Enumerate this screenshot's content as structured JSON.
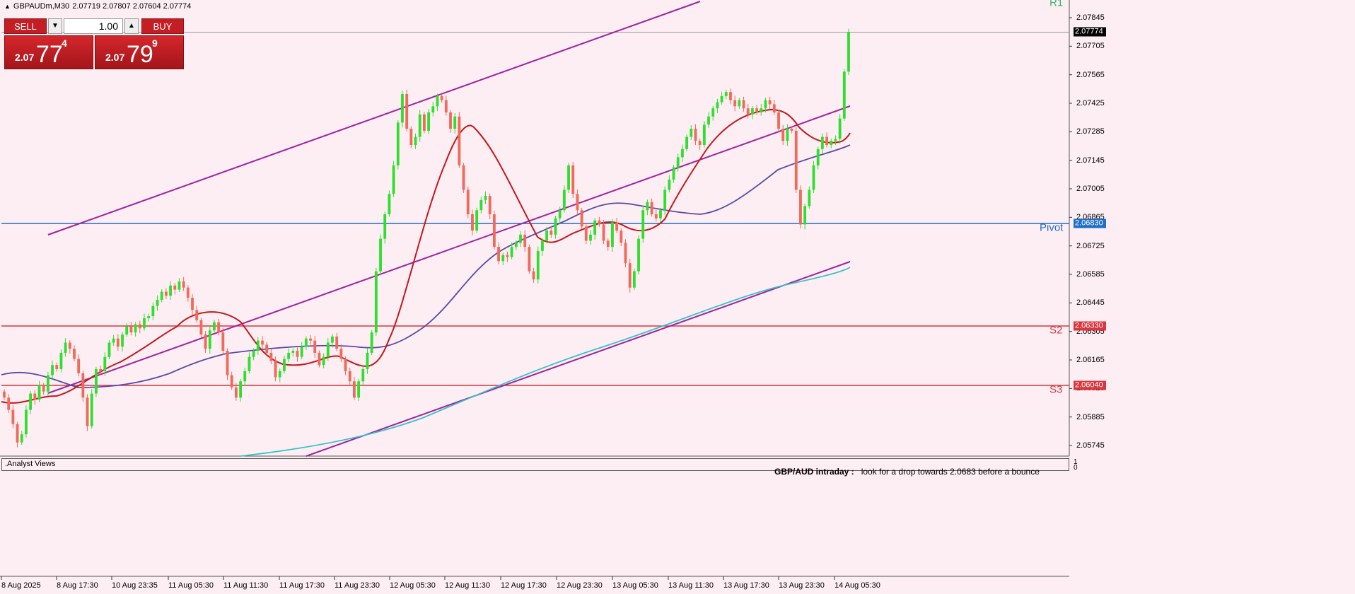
{
  "window": {
    "title": "GBPAUDm,M30",
    "ohlc": "2.07719 2.07807 2.07604 2.07774"
  },
  "trade_panel": {
    "sell_label": "SELL",
    "buy_label": "BUY",
    "lot": "1.00",
    "sell_prefix": "2.07",
    "sell_main": "77",
    "sell_sup": "4",
    "buy_prefix": "2.07",
    "buy_main": "79",
    "buy_sup": "9"
  },
  "price_axis": {
    "ticks": [
      "2.07845",
      "2.07705",
      "2.07565",
      "2.07425",
      "2.07285",
      "2.07145",
      "2.07005",
      "2.06865",
      "2.06725",
      "2.06585",
      "2.06445",
      "2.06305",
      "2.06165",
      "2.06025",
      "2.05885",
      "2.05745"
    ],
    "current_price": "2.07774"
  },
  "levels": [
    {
      "name": "R1",
      "price": "",
      "color": "#3cb371"
    },
    {
      "name": "Pivot",
      "price": "2.06830",
      "color": "#1e6fc8"
    },
    {
      "name": "S2",
      "price": "2.06330",
      "color": "#d9363e"
    },
    {
      "name": "S3",
      "price": "2.06040",
      "color": "#d9363e"
    }
  ],
  "time_axis": [
    "8 Aug 2025",
    "8 Aug 17:30",
    "10 Aug 23:35",
    "11 Aug 05:30",
    "11 Aug 11:30",
    "11 Aug 17:30",
    "11 Aug 23:30",
    "12 Aug 05:30",
    "12 Aug 11:30",
    "12 Aug 17:30",
    "12 Aug 23:30",
    "13 Aug 05:30",
    "13 Aug 11:30",
    "13 Aug 17:30",
    "13 Aug 23:30",
    "14 Aug 05:30"
  ],
  "indicator_panel": {
    "name": ".Analyst Views",
    "headline": "GBP/AUD intraday :",
    "text": "look for a drop towards 2.0683 before a bounce",
    "axis_top": "1",
    "axis_bottom": "0"
  },
  "colors": {
    "background": "#fdeef3",
    "bull": "#2ee02e",
    "bear": "#f06a5a",
    "channel": "#a0229e",
    "ma_fast": "#c4161c",
    "ma_mid": "#5a4aa8",
    "ma_slow": "#36c4c4"
  }
}
